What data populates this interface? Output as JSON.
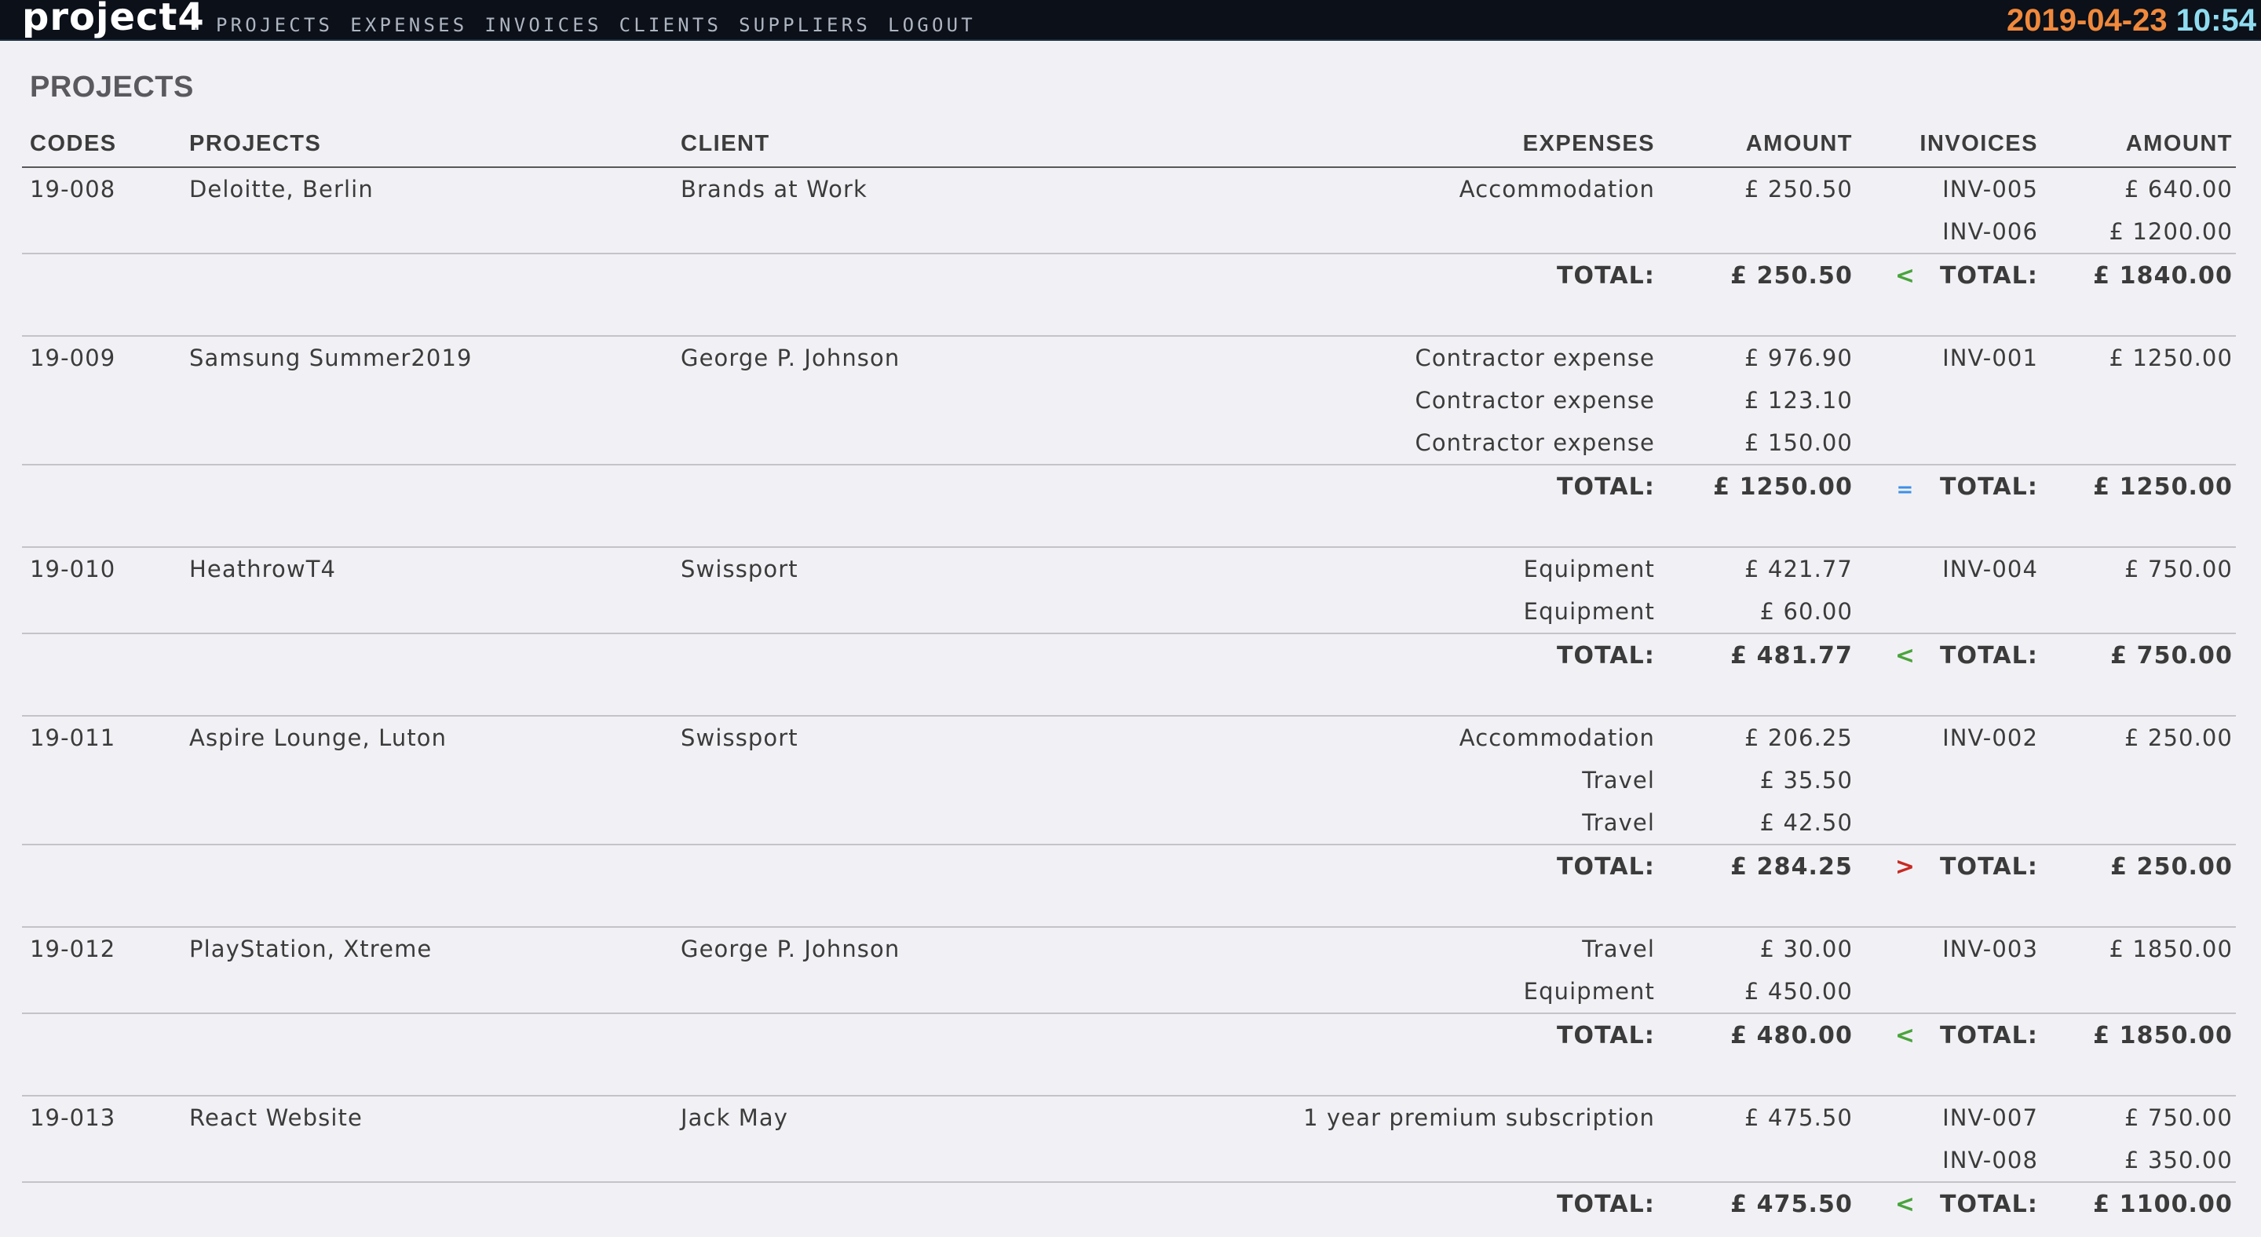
{
  "app": {
    "logo": "project4",
    "nav_separator": ".",
    "nav": [
      "PROJECTS",
      "EXPENSES",
      "INVOICES",
      "CLIENTS",
      "SUPPLIERS",
      "LOGOUT"
    ],
    "date": "2019-04-23",
    "time": "10:54"
  },
  "page": {
    "title": "PROJECTS",
    "columns": {
      "codes": "CODES",
      "projects": "PROJECTS",
      "client": "CLIENT",
      "expenses": "EXPENSES",
      "amount": "AMOUNT",
      "invoices": "INVOICES",
      "invoice_amount": "AMOUNT"
    },
    "total_label": "TOTAL:"
  },
  "colors": {
    "less": "#4aa43c",
    "more": "#c82a22",
    "equal": "#3d8fe8"
  },
  "projects": [
    {
      "code": "19-008",
      "name": "Deloitte, Berlin",
      "client": "Brands at Work",
      "expenses": [
        {
          "desc": "Accommodation",
          "amount": "£ 250.50"
        }
      ],
      "invoices": [
        {
          "id": "INV-005",
          "amount": "£ 640.00"
        },
        {
          "id": "INV-006",
          "amount": "£ 1200.00"
        }
      ],
      "expense_total": "£ 250.50",
      "comparison": "less",
      "comparison_icon": "less-than-icon",
      "invoice_total": "£ 1840.00"
    },
    {
      "code": "19-009",
      "name": "Samsung Summer2019",
      "client": "George P. Johnson",
      "expenses": [
        {
          "desc": "Contractor expense",
          "amount": "£ 976.90"
        },
        {
          "desc": "Contractor expense",
          "amount": "£ 123.10"
        },
        {
          "desc": "Contractor expense",
          "amount": "£ 150.00"
        }
      ],
      "invoices": [
        {
          "id": "INV-001",
          "amount": "£ 1250.00"
        }
      ],
      "expense_total": "£ 1250.00",
      "comparison": "equal",
      "comparison_icon": "equals-icon",
      "invoice_total": "£ 1250.00"
    },
    {
      "code": "19-010",
      "name": "HeathrowT4",
      "client": "Swissport",
      "expenses": [
        {
          "desc": "Equipment",
          "amount": "£ 421.77"
        },
        {
          "desc": "Equipment",
          "amount": "£ 60.00"
        }
      ],
      "invoices": [
        {
          "id": "INV-004",
          "amount": "£ 750.00"
        }
      ],
      "expense_total": "£ 481.77",
      "comparison": "less",
      "comparison_icon": "less-than-icon",
      "invoice_total": "£ 750.00"
    },
    {
      "code": "19-011",
      "name": "Aspire Lounge, Luton",
      "client": "Swissport",
      "expenses": [
        {
          "desc": "Accommodation",
          "amount": "£ 206.25"
        },
        {
          "desc": "Travel",
          "amount": "£ 35.50"
        },
        {
          "desc": "Travel",
          "amount": "£ 42.50"
        }
      ],
      "invoices": [
        {
          "id": "INV-002",
          "amount": "£ 250.00"
        }
      ],
      "expense_total": "£ 284.25",
      "comparison": "more",
      "comparison_icon": "greater-than-icon",
      "invoice_total": "£ 250.00"
    },
    {
      "code": "19-012",
      "name": "PlayStation, Xtreme",
      "client": "George P. Johnson",
      "expenses": [
        {
          "desc": "Travel",
          "amount": "£ 30.00"
        },
        {
          "desc": "Equipment",
          "amount": "£ 450.00"
        }
      ],
      "invoices": [
        {
          "id": "INV-003",
          "amount": "£ 1850.00"
        }
      ],
      "expense_total": "£ 480.00",
      "comparison": "less",
      "comparison_icon": "less-than-icon",
      "invoice_total": "£ 1850.00"
    },
    {
      "code": "19-013",
      "name": "React Website",
      "client": "Jack May",
      "expenses": [
        {
          "desc": "1 year premium subscription",
          "amount": "£ 475.50"
        }
      ],
      "invoices": [
        {
          "id": "INV-007",
          "amount": "£ 750.00"
        },
        {
          "id": "INV-008",
          "amount": "£ 350.00"
        }
      ],
      "expense_total": "£ 475.50",
      "comparison": "less",
      "comparison_icon": "less-than-icon",
      "invoice_total": "£ 1100.00"
    }
  ]
}
